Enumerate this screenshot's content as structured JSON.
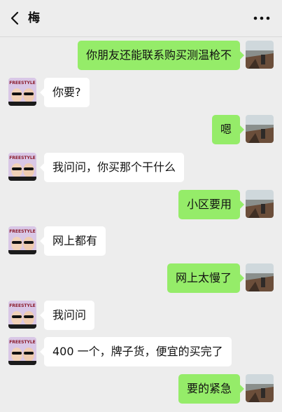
{
  "header": {
    "title": "梅",
    "back_icon": "chevron-left-icon",
    "more_icon": "more-dots-icon"
  },
  "messages": [
    {
      "side": "right",
      "text": "你朋友还能联系购买测温枪不"
    },
    {
      "side": "left",
      "text": "你要?"
    },
    {
      "side": "right",
      "text": "嗯"
    },
    {
      "side": "left",
      "text": "我问问，你买那个干什么"
    },
    {
      "side": "right",
      "text": "小区要用"
    },
    {
      "side": "left",
      "text": "网上都有"
    },
    {
      "side": "right",
      "text": "网上太慢了"
    },
    {
      "side": "left",
      "text": "我问问"
    },
    {
      "side": "left",
      "text": "400 一个，牌子货，便宜的买完了"
    },
    {
      "side": "right",
      "text": "要的紧急"
    }
  ],
  "avatars": {
    "contact_caption": "FREESTYLE"
  },
  "colors": {
    "background": "#ededed",
    "bubble_self": "#95ec69",
    "bubble_other": "#ffffff"
  }
}
